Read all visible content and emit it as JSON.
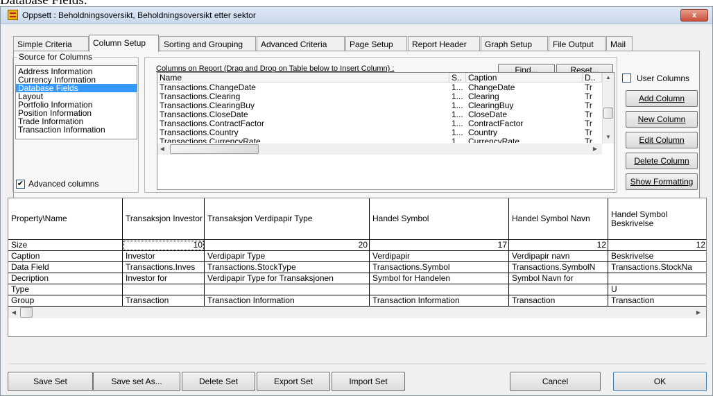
{
  "heading": "Database Fields.",
  "window": {
    "title": "Oppsett : Beholdningsoversikt, Beholdningsoversikt etter sektor",
    "close_label": "x"
  },
  "tabs": [
    {
      "label": "Simple Criteria"
    },
    {
      "label": "Column Setup"
    },
    {
      "label": "Sorting and Grouping"
    },
    {
      "label": "Advanced Criteria"
    },
    {
      "label": "Page Setup"
    },
    {
      "label": "Report Header"
    },
    {
      "label": "Graph Setup"
    },
    {
      "label": "File Output"
    },
    {
      "label": "Mail"
    }
  ],
  "source": {
    "legend": "Source for Columns",
    "items": [
      "Address Information",
      "Currency Information",
      "Database Fields",
      "Layout",
      "Portfolio Information",
      "Position Information",
      "Trade Information",
      "Transaction Information"
    ],
    "selected_index": 2,
    "advanced_label": "Advanced columns",
    "advanced_checked": "✔"
  },
  "columns_on_report": {
    "label": "Columns on Report (Drag and Drop on Table below to Insert Column) :",
    "find_label": "Find...",
    "reset_label": "Reset...",
    "headers": [
      "Name",
      "S..",
      "Caption",
      "D.."
    ],
    "rows": [
      [
        "Transactions.ChangeDate",
        "1...",
        "ChangeDate",
        "Tr"
      ],
      [
        "Transactions.Clearing",
        "1...",
        "Clearing",
        "Tr"
      ],
      [
        "Transactions.ClearingBuy",
        "1...",
        "ClearingBuy",
        "Tr"
      ],
      [
        "Transactions.CloseDate",
        "1...",
        "CloseDate",
        "Tr"
      ],
      [
        "Transactions.ContractFactor",
        "1...",
        "ContractFactor",
        "Tr"
      ],
      [
        "Transactions.Country",
        "1...",
        "Country",
        "Tr"
      ],
      [
        "Transactions.CurrencyRate",
        "1...",
        "CurrencyRate",
        "Tr"
      ]
    ]
  },
  "user_columns": {
    "label": "User Columns",
    "add": "Add Column",
    "new": "New Column",
    "edit": "Edit Column",
    "delete": "Delete Column",
    "show": "Show Formatting"
  },
  "property_grid": {
    "headers": [
      "Property\\Name",
      "Transaksjon Investor",
      "Transaksjon Verdipapir Type",
      "Handel Symbol",
      "Handel Symbol Navn",
      "Handel Symbol Beskrivelse"
    ],
    "rows": [
      {
        "label": "Size",
        "cells": [
          "10",
          "20",
          "17",
          "12",
          "12"
        ]
      },
      {
        "label": "Caption",
        "cells": [
          "Investor",
          "Verdipapir Type",
          "Verdipapir",
          "Verdipapir navn",
          "Beskrivelse"
        ]
      },
      {
        "label": "Data Field",
        "cells": [
          "Transactions.Inves",
          "Transactions.StockType",
          "Transactions.Symbol",
          "Transactions.SymbolN",
          "Transactions.StockNa"
        ]
      },
      {
        "label": "Decription",
        "cells": [
          "Investor for",
          "Verdipapir Type for Transaksjonen",
          "Symbol for Handelen",
          "Symbol Navn for",
          ""
        ]
      },
      {
        "label": "Type",
        "cells": [
          "",
          "",
          "",
          "",
          "U"
        ]
      },
      {
        "label": "Group",
        "cells": [
          "Transaction",
          "Transaction Information",
          "Transaction Information",
          "Transaction",
          "Transaction"
        ]
      }
    ]
  },
  "bottom": {
    "save_set": "Save Set",
    "save_set_as": "Save set As...",
    "delete_set": "Delete Set",
    "export_set": "Export Set",
    "import_set": "Import Set",
    "cancel": "Cancel",
    "ok": "OK"
  },
  "colors": {
    "selection": "#3399ff",
    "titlebar": "#c9d8ea",
    "close": "#c8503a"
  }
}
